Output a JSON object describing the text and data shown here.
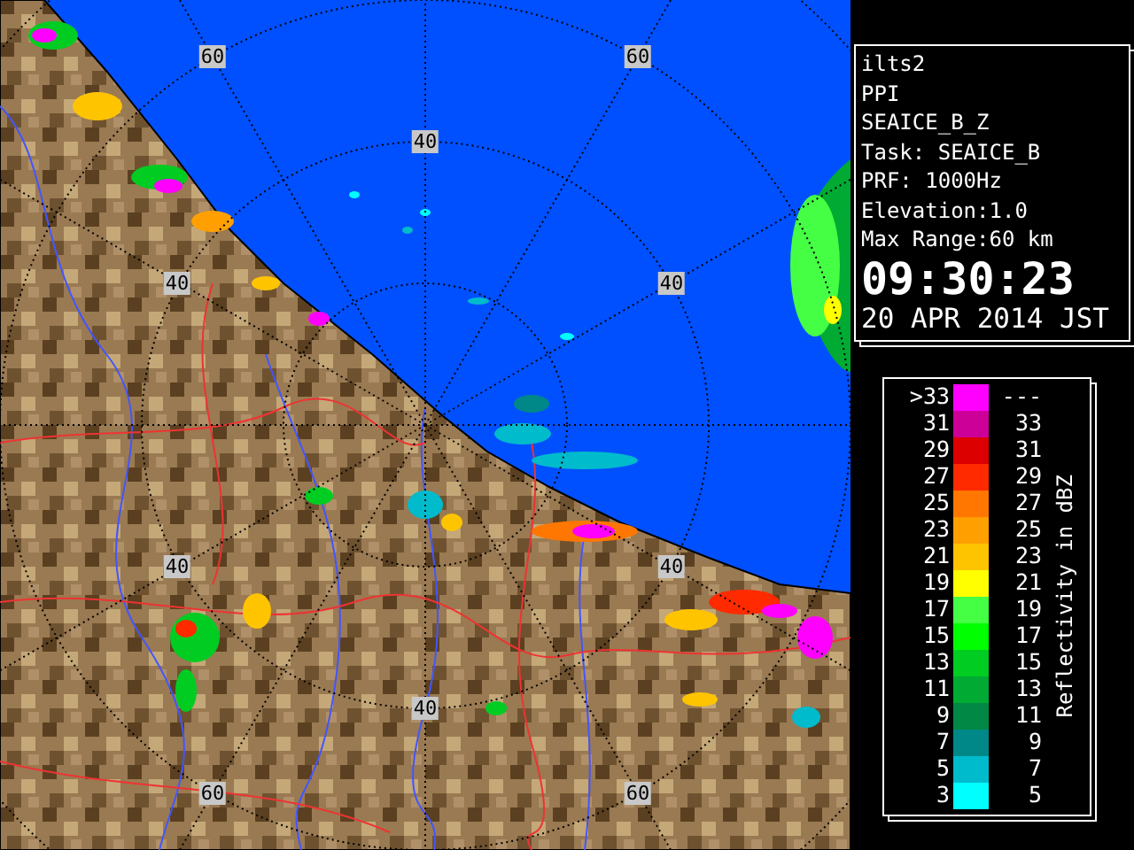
{
  "radar_map": {
    "range_labels": [
      "60",
      "60",
      "40",
      "40",
      "40",
      "40",
      "40",
      "40",
      "60",
      "60"
    ]
  },
  "info_panel": {
    "lines": [
      "ilts2",
      "PPI",
      "SEAICE_B_Z",
      "Task: SEAICE_B",
      "PRF: 1000Hz",
      "Elevation:1.0",
      "Max Range:60 km"
    ],
    "time": "09:30:23",
    "date": "20 APR 2014 JST"
  },
  "legend": {
    "title": "Reflectivity in dBZ",
    "entries": [
      {
        "low": ">33",
        "high": "---",
        "color": "#ff00ff"
      },
      {
        "low": "31",
        "high": "33",
        "color": "#cc0099"
      },
      {
        "low": "29",
        "high": "31",
        "color": "#dd0000"
      },
      {
        "low": "27",
        "high": "29",
        "color": "#ff2a00"
      },
      {
        "low": "25",
        "high": "27",
        "color": "#ff7700"
      },
      {
        "low": "23",
        "high": "25",
        "color": "#ffa000"
      },
      {
        "low": "21",
        "high": "23",
        "color": "#ffc400"
      },
      {
        "low": "19",
        "high": "21",
        "color": "#ffff00"
      },
      {
        "low": "17",
        "high": "19",
        "color": "#44ff44"
      },
      {
        "low": "15",
        "high": "17",
        "color": "#00ff00"
      },
      {
        "low": "13",
        "high": "15",
        "color": "#00cc22"
      },
      {
        "low": "11",
        "high": "13",
        "color": "#00aa33"
      },
      {
        "low": "9",
        "high": "11",
        "color": "#008844"
      },
      {
        "low": "7",
        "high": "9",
        "color": "#008888"
      },
      {
        "low": "5",
        "high": "7",
        "color": "#00bbcc"
      },
      {
        "low": "3",
        "high": "5",
        "color": "#00ffff"
      }
    ]
  }
}
